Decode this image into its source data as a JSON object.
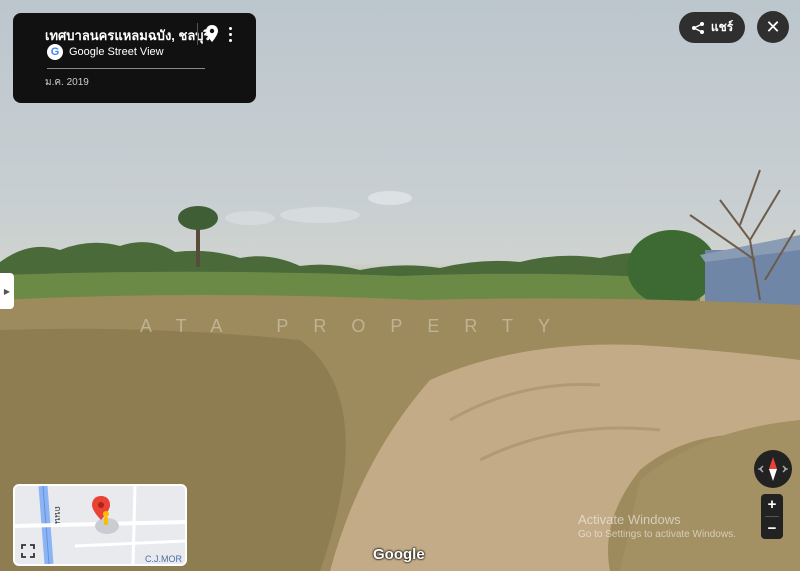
{
  "info_card": {
    "title": "เทศบาลนครแหลมฉบัง, ชลบุรี",
    "service_label": "Google Street View",
    "service_logo_letter": "G",
    "capture_date": "ม.ค. 2019",
    "pin_icon": "location-pin-icon",
    "more_icon": "more-vert-icon"
  },
  "share": {
    "label": "แชร์",
    "icon": "share-icon"
  },
  "close": {
    "icon": "close-icon",
    "glyph": "✕"
  },
  "side_panel_toggle": {
    "glyph": "▶",
    "icon": "chevron-right-icon"
  },
  "watermark": "ATA PROPERTY",
  "minimap": {
    "road_label": "ถนน",
    "corner_label": "C.J.MOR",
    "fullscreen_icon": "fullscreen-icon"
  },
  "google_wordmark": "Google",
  "os_watermark": {
    "title": "Activate Windows",
    "subtitle": "Go to Settings to activate Windows."
  },
  "controls": {
    "compass_icon": "compass-icon",
    "zoom_in": "+",
    "zoom_out": "−"
  },
  "colors": {
    "panel_bg": "#111111",
    "button_bg": "#2f2f2f",
    "pin_red": "#ea4335"
  }
}
